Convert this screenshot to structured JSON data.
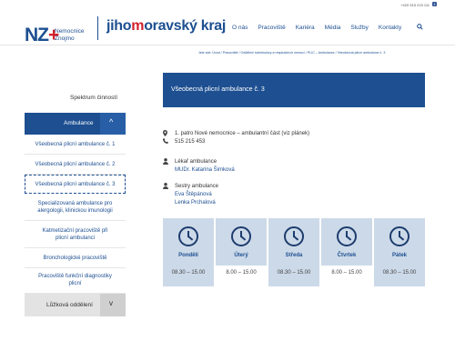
{
  "topbar": {
    "phone": "+420 515 215 111",
    "facebook_icon": "facebook-icon"
  },
  "logo": {
    "mark": "NZ",
    "plus": "+",
    "line1": "Nemocnice",
    "line2": "Znojmo"
  },
  "region": {
    "part1": "jiho",
    "part2": "m",
    "part3": "oravský kraj"
  },
  "nav": {
    "items": [
      "O nás",
      "Pracoviště",
      "Kariéra",
      "Média",
      "Služby",
      "Kontakty"
    ],
    "search_icon": "search-icon"
  },
  "breadcrumb": "Jste zde: Úvod / Pracoviště / Oddělení tuberkulózy a respiračních nemocí / PLIC – Ambulance / Všeobecná plicní ambulance č. 3",
  "sidebar": {
    "title": "Spektrum činností",
    "ambulance": {
      "label": "Ambulance",
      "toggle": "^"
    },
    "items": [
      {
        "line1": "Všeobecná plicní ambulance č. 1",
        "line2": ""
      },
      {
        "line1": "Všeobecná plicní ambulance č. 2",
        "line2": ""
      },
      {
        "line1": "Všeobecná plicní ambulance č. 3",
        "line2": ""
      },
      {
        "line1": "Specializovaná ambulance pro",
        "line2": "alergologii, klinickou imunologii"
      },
      {
        "line1": "Katmetizační pracoviště při",
        "line2": "plicní ambulanci"
      },
      {
        "line1": "Bronchologické pracoviště",
        "line2": ""
      },
      {
        "line1": "Pracoviště funkční diagnostiky",
        "line2": "plicní"
      }
    ],
    "luzkova": {
      "label": "Lůžková oddělení",
      "toggle": "v"
    }
  },
  "main": {
    "title": "Všeobecná plicní ambulance č. 3",
    "location": "1. patro Nové nemocnice – ambulantní část (viz plánek)",
    "phone": "515 215 453",
    "doctor_label": "Lékař ambulance",
    "doctor_name": "MUDr. Katarina Šimková",
    "nurses_label": "Sestry ambulance",
    "nurse1": "Eva Štěpánová",
    "nurse2": "Lenka Prchalová"
  },
  "days": [
    {
      "name": "Pondělí",
      "hours": "08.30 – 15.00"
    },
    {
      "name": "Úterý",
      "hours": "8.00 – 15.00"
    },
    {
      "name": "Středa",
      "hours": "08.30 – 15.00"
    },
    {
      "name": "Čtvrtek",
      "hours": "8.00 – 15.00"
    },
    {
      "name": "Pátek",
      "hours": "08.30 – 15.00"
    }
  ]
}
